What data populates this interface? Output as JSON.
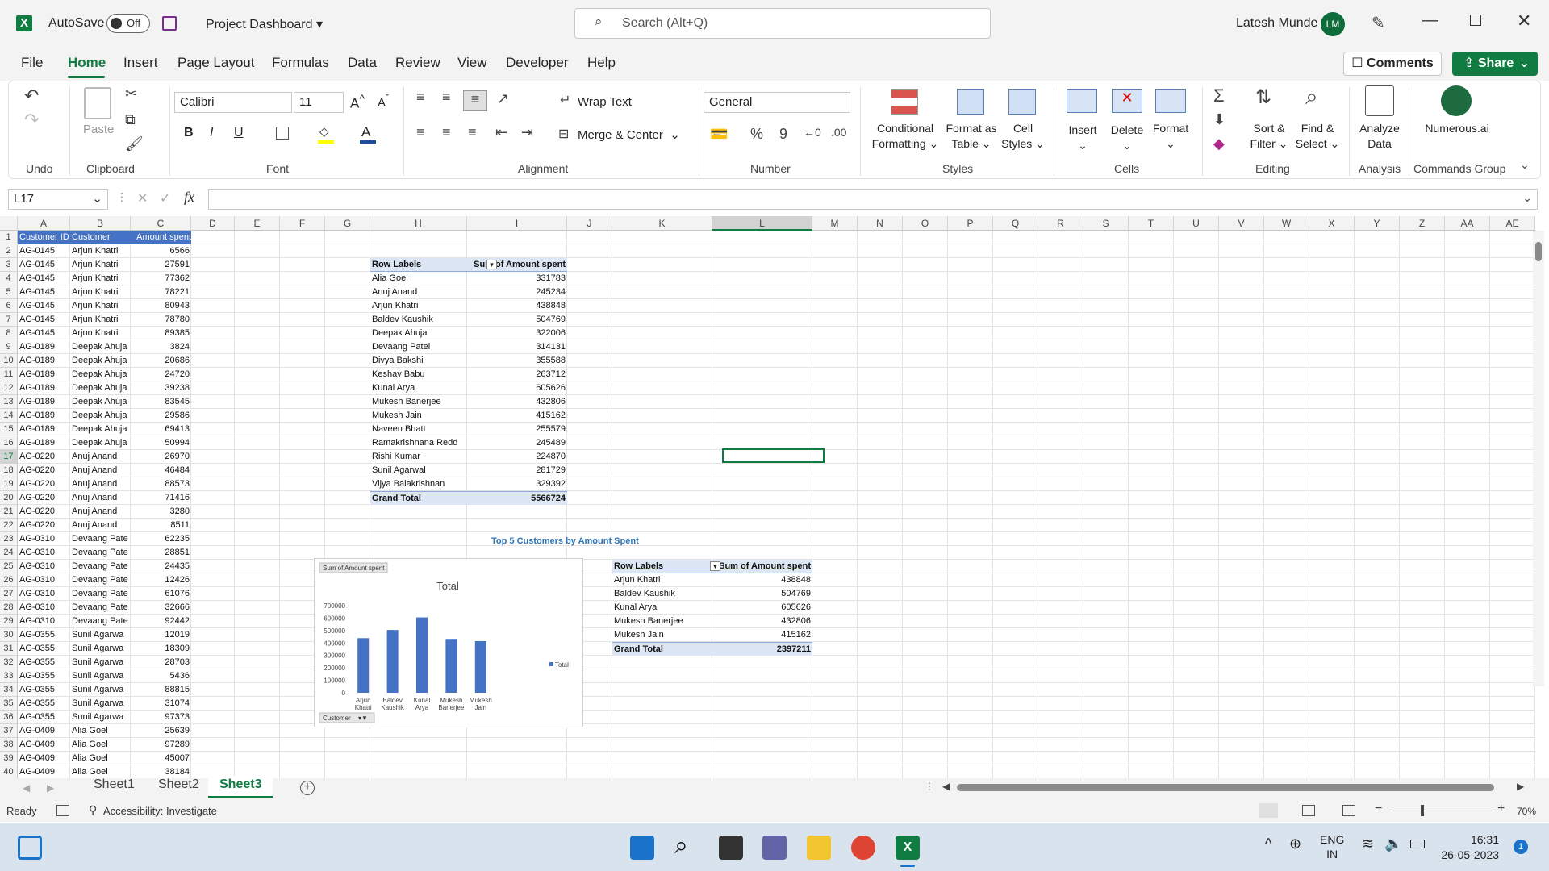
{
  "titlebar": {
    "autosave_label": "AutoSave",
    "autosave_state": "Off",
    "file_name": "Project Dashboard",
    "search_placeholder": "Search (Alt+Q)",
    "user_name": "Latesh Munde",
    "user_initials": "LM"
  },
  "menu": {
    "tabs": [
      "File",
      "Home",
      "Insert",
      "Page Layout",
      "Formulas",
      "Data",
      "Review",
      "View",
      "Developer",
      "Help"
    ],
    "comments": "Comments",
    "share": "Share"
  },
  "ribbon": {
    "groups": [
      "Undo",
      "Clipboard",
      "Font",
      "Alignment",
      "Number",
      "Styles",
      "Cells",
      "Editing",
      "Analysis",
      "Commands Group"
    ],
    "paste": "Paste",
    "font_name": "Calibri",
    "font_size": "11",
    "wrap_text": "Wrap Text",
    "merge_center": "Merge & Center",
    "number_format": "General",
    "conditional_formatting": [
      "Conditional",
      "Formatting"
    ],
    "format_as_table": [
      "Format as",
      "Table"
    ],
    "cell_styles": [
      "Cell",
      "Styles"
    ],
    "insert": "Insert",
    "delete": "Delete",
    "format": "Format",
    "sort_filter": [
      "Sort &",
      "Filter"
    ],
    "find_select": [
      "Find &",
      "Select"
    ],
    "analyze_data": [
      "Analyze",
      "Data"
    ],
    "numerous": "Numerous.ai"
  },
  "formula_bar": {
    "name_box": "L17",
    "fx": "fx",
    "content": ""
  },
  "columns": [
    "A",
    "B",
    "C",
    "D",
    "E",
    "F",
    "G",
    "H",
    "I",
    "J",
    "K",
    "L",
    "M",
    "N",
    "O",
    "P",
    "Q",
    "R",
    "S",
    "T",
    "U",
    "V",
    "W",
    "X",
    "Y",
    "Z",
    "AA",
    "AE"
  ],
  "table": {
    "headers": [
      "Customer ID",
      "Customer",
      "Amount spent"
    ],
    "rows": [
      [
        "AG-0145",
        "Arjun Khatri",
        "6566"
      ],
      [
        "AG-0145",
        "Arjun Khatri",
        "27591"
      ],
      [
        "AG-0145",
        "Arjun Khatri",
        "77362"
      ],
      [
        "AG-0145",
        "Arjun Khatri",
        "78221"
      ],
      [
        "AG-0145",
        "Arjun Khatri",
        "80943"
      ],
      [
        "AG-0145",
        "Arjun Khatri",
        "78780"
      ],
      [
        "AG-0145",
        "Arjun Khatri",
        "89385"
      ],
      [
        "AG-0189",
        "Deepak Ahuja",
        "3824"
      ],
      [
        "AG-0189",
        "Deepak Ahuja",
        "20686"
      ],
      [
        "AG-0189",
        "Deepak Ahuja",
        "24720"
      ],
      [
        "AG-0189",
        "Deepak Ahuja",
        "39238"
      ],
      [
        "AG-0189",
        "Deepak Ahuja",
        "83545"
      ],
      [
        "AG-0189",
        "Deepak Ahuja",
        "29586"
      ],
      [
        "AG-0189",
        "Deepak Ahuja",
        "69413"
      ],
      [
        "AG-0189",
        "Deepak Ahuja",
        "50994"
      ],
      [
        "AG-0220",
        "Anuj Anand",
        "26970"
      ],
      [
        "AG-0220",
        "Anuj Anand",
        "46484"
      ],
      [
        "AG-0220",
        "Anuj Anand",
        "88573"
      ],
      [
        "AG-0220",
        "Anuj Anand",
        "71416"
      ],
      [
        "AG-0220",
        "Anuj Anand",
        "3280"
      ],
      [
        "AG-0220",
        "Anuj Anand",
        "8511"
      ],
      [
        "AG-0310",
        "Devaang Pate",
        "62235"
      ],
      [
        "AG-0310",
        "Devaang Pate",
        "28851"
      ],
      [
        "AG-0310",
        "Devaang Pate",
        "24435"
      ],
      [
        "AG-0310",
        "Devaang Pate",
        "12426"
      ],
      [
        "AG-0310",
        "Devaang Pate",
        "61076"
      ],
      [
        "AG-0310",
        "Devaang Pate",
        "32666"
      ],
      [
        "AG-0310",
        "Devaang Pate",
        "92442"
      ],
      [
        "AG-0355",
        "Sunil Agarwa",
        "12019"
      ],
      [
        "AG-0355",
        "Sunil Agarwa",
        "18309"
      ],
      [
        "AG-0355",
        "Sunil Agarwa",
        "28703"
      ],
      [
        "AG-0355",
        "Sunil Agarwa",
        "5436"
      ],
      [
        "AG-0355",
        "Sunil Agarwa",
        "88815"
      ],
      [
        "AG-0355",
        "Sunil Agarwa",
        "31074"
      ],
      [
        "AG-0355",
        "Sunil Agarwa",
        "97373"
      ],
      [
        "AG-0409",
        "Alia Goel",
        "25639"
      ],
      [
        "AG-0409",
        "Alia Goel",
        "97289"
      ],
      [
        "AG-0409",
        "Alia Goel",
        "45007"
      ],
      [
        "AG-0409",
        "Alia Goel",
        "38184"
      ]
    ]
  },
  "pivot1": {
    "headers": [
      "Row Labels",
      "Sum of Amount spent"
    ],
    "rows": [
      [
        "Alia Goel",
        "331783"
      ],
      [
        "Anuj Anand",
        "245234"
      ],
      [
        "Arjun Khatri",
        "438848"
      ],
      [
        "Baldev Kaushik",
        "504769"
      ],
      [
        "Deepak Ahuja",
        "322006"
      ],
      [
        "Devaang Patel",
        "314131"
      ],
      [
        "Divya Bakshi",
        "355588"
      ],
      [
        "Keshav Babu",
        "263712"
      ],
      [
        "Kunal Arya",
        "605626"
      ],
      [
        "Mukesh Banerjee",
        "432806"
      ],
      [
        "Mukesh Jain",
        "415162"
      ],
      [
        "Naveen Bhatt",
        "255579"
      ],
      [
        "Ramakrishnana Redd",
        "245489"
      ],
      [
        "Rishi Kumar",
        "224870"
      ],
      [
        "Sunil Agarwal",
        "281729"
      ],
      [
        "Vijya Balakrishnan",
        "329392"
      ]
    ],
    "total_label": "Grand Total",
    "total_value": "5566724"
  },
  "pivot2": {
    "title": "Top 5 Customers by Amount Spent",
    "headers": [
      "Row Labels",
      "Sum of Amount spent"
    ],
    "rows": [
      [
        "Arjun Khatri",
        "438848"
      ],
      [
        "Baldev Kaushik",
        "504769"
      ],
      [
        "Kunal Arya",
        "605626"
      ],
      [
        "Mukesh Banerjee",
        "432806"
      ],
      [
        "Mukesh Jain",
        "415162"
      ]
    ],
    "total_label": "Grand Total",
    "total_value": "2397211"
  },
  "chart_data": {
    "type": "bar",
    "title": "Total",
    "field_button": "Sum of Amount spent",
    "axis_button": "Customer",
    "categories": [
      [
        "Arjun",
        "Khatri"
      ],
      [
        "Baldev",
        "Kaushik"
      ],
      [
        "Kunal",
        "Arya"
      ],
      [
        "Mukesh",
        "Banerjee"
      ],
      [
        "Mukesh",
        "Jain"
      ]
    ],
    "series": [
      {
        "name": "Total",
        "values": [
          438848,
          504769,
          605626,
          432806,
          415162
        ]
      }
    ],
    "ylim": [
      0,
      700000
    ],
    "yticks": [
      "700000",
      "600000",
      "500000",
      "400000",
      "300000",
      "200000",
      "100000",
      "0"
    ],
    "bar_color": "#4472c4",
    "legend": "right"
  },
  "sheets": {
    "tabs": [
      "Sheet1",
      "Sheet2",
      "Sheet3"
    ],
    "active": "Sheet3"
  },
  "status": {
    "ready": "Ready",
    "accessibility": "Accessibility: Investigate",
    "zoom": "70%"
  },
  "taskbar": {
    "lang1": "ENG",
    "lang2": "IN",
    "time": "16:31",
    "date": "26-05-2023",
    "badge": "1"
  }
}
